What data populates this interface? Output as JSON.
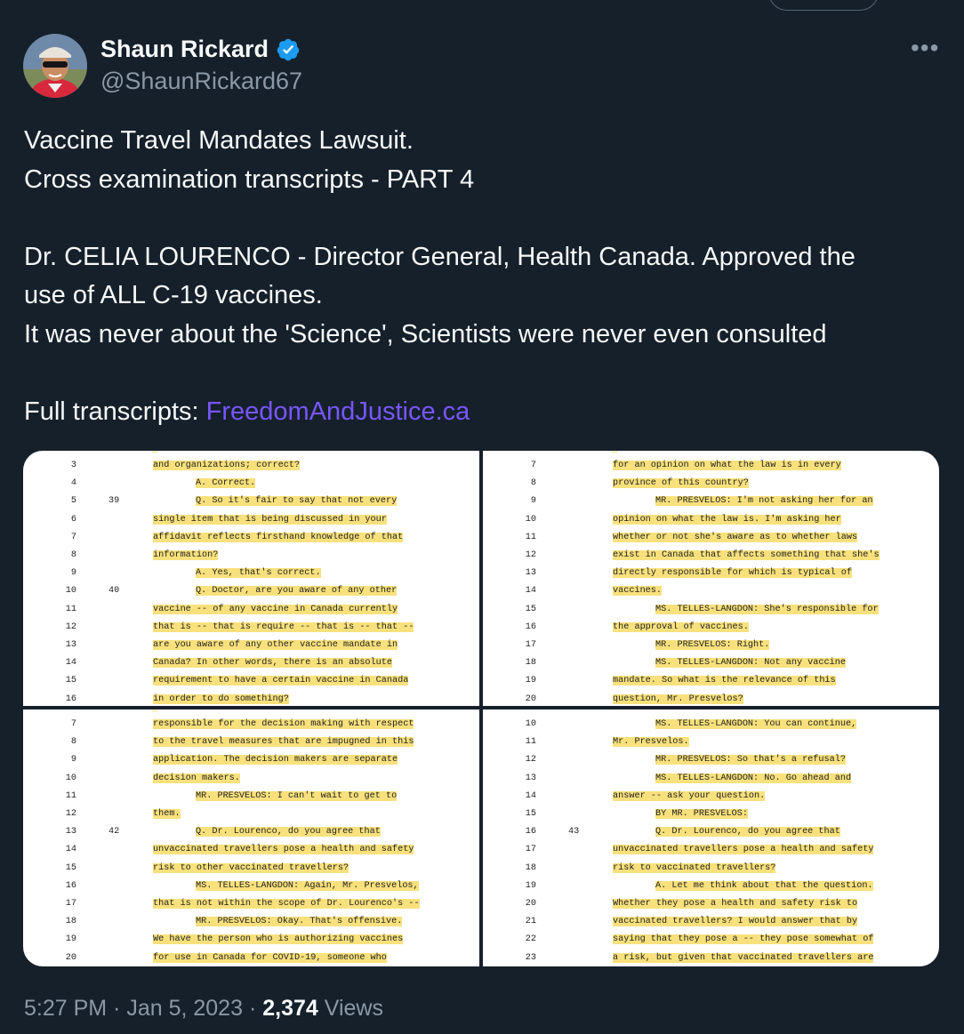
{
  "author": {
    "name": "Shaun Rickard",
    "handle": "@ShaunRickard67",
    "verified": true
  },
  "icons": {
    "more": "more-horizontal-icon",
    "verified": "verified-badge-icon"
  },
  "colors": {
    "background": "#15202b",
    "link": "#7856ff",
    "verified": "#1d9bf0",
    "highlight": "#f8e17c",
    "secondary_text": "#8b98a5"
  },
  "tweet": {
    "lines": [
      "Vaccine Travel Mandates Lawsuit.",
      "Cross examination transcripts - PART 4",
      "",
      "Dr. CELIA LOURENCO - Director General, Health Canada. Approved the",
      "use of ALL C-19 vaccines.",
      "It was never about the 'Science', Scientists were never even consulted",
      ""
    ],
    "link_prefix": "Full transcripts: ",
    "link_text": "FreedomAndJustice.ca"
  },
  "transcripts": [
    {
      "lines": [
        {
          "n": "3",
          "q": "",
          "ind": 0,
          "t": "and organizations; correct?"
        },
        {
          "n": "4",
          "q": "",
          "ind": 1,
          "t": "A.   Correct."
        },
        {
          "n": "5",
          "q": "39",
          "ind": 1,
          "t": "Q.   So it's fair to say that not every"
        },
        {
          "n": "6",
          "q": "",
          "ind": 0,
          "t": "single item that is being discussed in your"
        },
        {
          "n": "7",
          "q": "",
          "ind": 0,
          "t": "affidavit reflects firsthand knowledge of that"
        },
        {
          "n": "8",
          "q": "",
          "ind": 0,
          "t": "information?"
        },
        {
          "n": "9",
          "q": "",
          "ind": 1,
          "t": "A.   Yes, that's correct."
        },
        {
          "n": "10",
          "q": "40",
          "ind": 1,
          "t": "Q.   Doctor, are you aware of any other"
        },
        {
          "n": "11",
          "q": "",
          "ind": 0,
          "t": "vaccine -- of any vaccine in Canada currently"
        },
        {
          "n": "12",
          "q": "",
          "ind": 0,
          "t": "that is -- that is require -- that is -- that --"
        },
        {
          "n": "13",
          "q": "",
          "ind": 0,
          "t": "are you aware of any other vaccine mandate in"
        },
        {
          "n": "14",
          "q": "",
          "ind": 0,
          "t": "Canada?  In other words, there is an absolute"
        },
        {
          "n": "15",
          "q": "",
          "ind": 0,
          "t": "requirement to have a certain vaccine in Canada"
        },
        {
          "n": "16",
          "q": "",
          "ind": 0,
          "t": "in order to do something?"
        }
      ]
    },
    {
      "lines": [
        {
          "n": "7",
          "q": "",
          "ind": 0,
          "t": "for an opinion on what the law is in every"
        },
        {
          "n": "8",
          "q": "",
          "ind": 0,
          "t": "province of this country?"
        },
        {
          "n": "9",
          "q": "",
          "ind": 1,
          "t": "MR. PRESVELOS:  I'm not asking her for an"
        },
        {
          "n": "10",
          "q": "",
          "ind": 0,
          "t": "opinion on what the law is.  I'm asking her"
        },
        {
          "n": "11",
          "q": "",
          "ind": 0,
          "t": "whether or not she's aware as to whether laws"
        },
        {
          "n": "12",
          "q": "",
          "ind": 0,
          "t": "exist in Canada that affects something that she's"
        },
        {
          "n": "13",
          "q": "",
          "ind": 0,
          "t": "directly responsible for which is typical of"
        },
        {
          "n": "14",
          "q": "",
          "ind": 0,
          "t": "vaccines."
        },
        {
          "n": "15",
          "q": "",
          "ind": 1,
          "t": "MS. TELLES-LANGDON:  She's responsible for"
        },
        {
          "n": "16",
          "q": "",
          "ind": 0,
          "t": "the approval of vaccines."
        },
        {
          "n": "17",
          "q": "",
          "ind": 1,
          "t": "MR. PRESVELOS:  Right."
        },
        {
          "n": "18",
          "q": "",
          "ind": 1,
          "t": "MS. TELLES-LANGDON:  Not any vaccine"
        },
        {
          "n": "19",
          "q": "",
          "ind": 0,
          "t": "mandate.  So what is the relevance of this"
        },
        {
          "n": "20",
          "q": "",
          "ind": 0,
          "t": "question, Mr. Presvelos?"
        }
      ]
    },
    {
      "lines": [
        {
          "n": "7",
          "q": "",
          "ind": 0,
          "t": "responsible for the decision making with respect"
        },
        {
          "n": "8",
          "q": "",
          "ind": 0,
          "t": "to the travel measures that are impugned in this"
        },
        {
          "n": "9",
          "q": "",
          "ind": 0,
          "t": "application.  The decision makers are separate"
        },
        {
          "n": "10",
          "q": "",
          "ind": 0,
          "t": "decision makers."
        },
        {
          "n": "11",
          "q": "",
          "ind": 1,
          "t": "MR. PRESVELOS:  I can't wait to get to"
        },
        {
          "n": "12",
          "q": "",
          "ind": 0,
          "t": "them."
        },
        {
          "n": "13",
          "q": "42",
          "ind": 1,
          "t": "Q.   Dr. Lourenco, do you agree that"
        },
        {
          "n": "14",
          "q": "",
          "ind": 0,
          "t": "unvaccinated travellers pose a health and safety"
        },
        {
          "n": "15",
          "q": "",
          "ind": 0,
          "t": "risk to other vaccinated travellers?"
        },
        {
          "n": "16",
          "q": "",
          "ind": 1,
          "t": "MS. TELLES-LANGDON:  Again, Mr. Presvelos,"
        },
        {
          "n": "17",
          "q": "",
          "ind": 0,
          "t": "that is not within the scope of Dr. Lourenco's --"
        },
        {
          "n": "18",
          "q": "",
          "ind": 1,
          "t": "MR. PRESVELOS:  Okay.  That's offensive."
        },
        {
          "n": "19",
          "q": "",
          "ind": 0,
          "t": "We have the person who is authorizing vaccines"
        },
        {
          "n": "20",
          "q": "",
          "ind": 0,
          "t": "for use in Canada for COVID-19, someone who"
        }
      ]
    },
    {
      "lines": [
        {
          "n": "10",
          "q": "",
          "ind": 1,
          "t": "MS. TELLES-LANGDON:  You can continue,"
        },
        {
          "n": "11",
          "q": "",
          "ind": 0,
          "t": "Mr. Presvelos."
        },
        {
          "n": "12",
          "q": "",
          "ind": 1,
          "t": "MR. PRESVELOS:  So that's a refusal?"
        },
        {
          "n": "13",
          "q": "",
          "ind": 1,
          "t": "MS. TELLES-LANGDON:  No.  Go ahead and"
        },
        {
          "n": "14",
          "q": "",
          "ind": 0,
          "t": "answer -- ask your question."
        },
        {
          "n": "15",
          "q": "",
          "ind": 1,
          "t": "BY MR. PRESVELOS:"
        },
        {
          "n": "16",
          "q": "43",
          "ind": 1,
          "t": "Q.   Dr. Lourenco, do you agree that"
        },
        {
          "n": "17",
          "q": "",
          "ind": 0,
          "t": "unvaccinated travellers pose a health and safety"
        },
        {
          "n": "18",
          "q": "",
          "ind": 0,
          "t": "risk to vaccinated travellers?"
        },
        {
          "n": "19",
          "q": "",
          "ind": 1,
          "t": "A.   Let me think about that the question."
        },
        {
          "n": "20",
          "q": "",
          "ind": 0,
          "t": "Whether they pose a health and safety risk to"
        },
        {
          "n": "21",
          "q": "",
          "ind": 0,
          "t": "vaccinated travellers?  I would answer that by"
        },
        {
          "n": "22",
          "q": "",
          "ind": 0,
          "t": "saying that they pose a -- they pose somewhat of"
        },
        {
          "n": "23",
          "q": "",
          "ind": 0,
          "t": "a risk, but given that vaccinated travellers are"
        }
      ]
    }
  ],
  "footer": {
    "time": "5:27 PM",
    "sep": " · ",
    "date": "Jan 5, 2023",
    "views_count": "2,374",
    "views_label": " Views"
  }
}
